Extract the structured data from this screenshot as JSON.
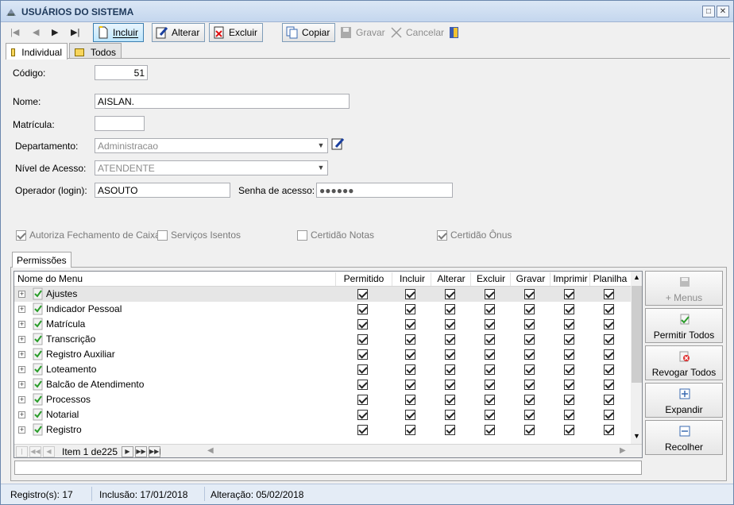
{
  "window": {
    "title": "USUÁRIOS DO SISTEMA"
  },
  "toolbar": {
    "incluir": "Incluir",
    "alterar": "Alterar",
    "excluir": "Excluir",
    "copiar": "Copiar",
    "gravar": "Gravar",
    "cancelar": "Cancelar"
  },
  "tabs": [
    "Individual",
    "Todos"
  ],
  "form": {
    "codigo_label": "Código:",
    "codigo_value": "51",
    "nome_label": "Nome:",
    "nome_value": "AISLAN.",
    "matricula_label": "Matrícula:",
    "matricula_value": "",
    "departamento_label": "Departamento:",
    "departamento_value": "Administracao",
    "nivel_label": "Nível de Acesso:",
    "nivel_value": "ATENDENTE",
    "operador_label": "Operador (login):",
    "operador_value": "ASOUTO",
    "senha_label": "Senha de acesso:",
    "senha_value": "●●●●●●"
  },
  "options": {
    "autoriza_fechamento": {
      "label": "Autoriza Fechamento de Caixa",
      "checked": true
    },
    "servicos_isentos": {
      "label": "Serviços Isentos",
      "checked": false
    },
    "certidao_notas": {
      "label": "Certidão Notas",
      "checked": false
    },
    "certidao_onus": {
      "label": "Certidão Ônus",
      "checked": true
    }
  },
  "permissions": {
    "tab_label": "Permissões",
    "columns": [
      "Nome do Menu",
      "Permitido",
      "Incluir",
      "Alterar",
      "Excluir",
      "Gravar",
      "Imprimir",
      "Planilha"
    ],
    "rows": [
      "Ajustes",
      "Indicador Pessoal",
      "Matrícula",
      "Transcrição",
      "Registro Auxiliar",
      "Loteamento",
      "Balcão de Atendimento",
      "Processos",
      "Notarial",
      "Registro"
    ],
    "pager": {
      "item_label": "Item 1 de",
      "total": "225"
    }
  },
  "side_buttons": {
    "menus": "+ Menus",
    "permitir_todos": "Permitir Todos",
    "revogar_todos": "Revogar Todos",
    "expandir": "Expandir",
    "recolher": "Recolher"
  },
  "status": {
    "registros": "Registro(s): 17",
    "inclusao": "Inclusão: 17/01/2018",
    "alteracao": "Alteração: 05/02/2018"
  }
}
